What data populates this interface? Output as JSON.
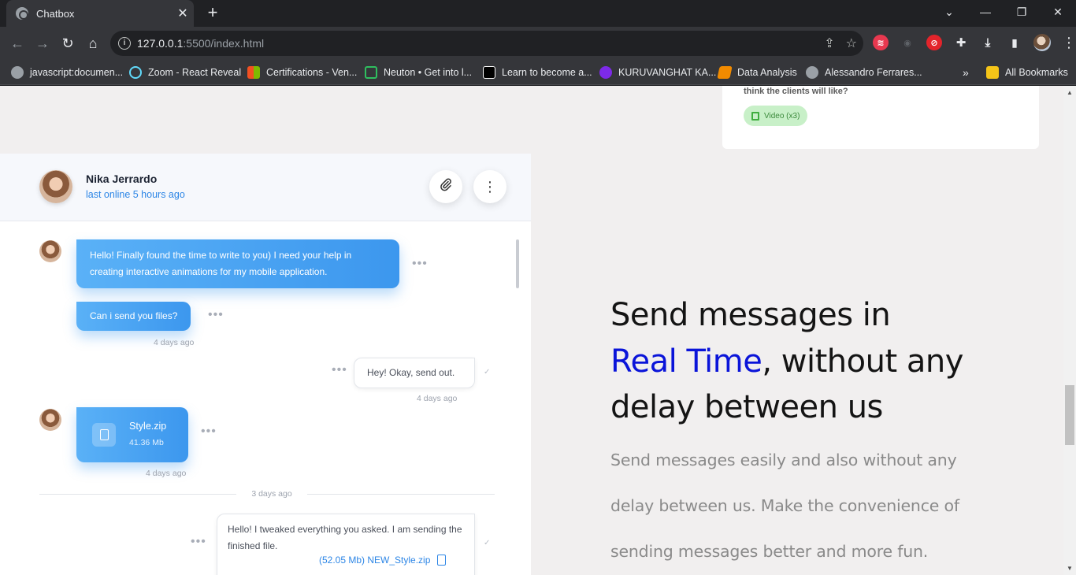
{
  "browser": {
    "tab_title": "Chatbox",
    "url_host": "127.0.0.1",
    "url_path": ":5500/index.html",
    "bookmarks": [
      {
        "label": "javascript:documen...",
        "icon": "globe-icon",
        "color": "#9aa0a6"
      },
      {
        "label": "Zoom - React Reveal",
        "icon": "react-icon",
        "color": "#61dafb"
      },
      {
        "label": "Certifications - Ven...",
        "icon": "microsoft-icon",
        "color": "#f25022"
      },
      {
        "label": "Neuton • Get into l...",
        "icon": "neuton-icon",
        "color": "#2fbf5f"
      },
      {
        "label": "Learn to become a...",
        "icon": "roadmap-icon",
        "color": "#ffffff"
      },
      {
        "label": "KURUVANGHAT KA...",
        "icon": "canva-icon",
        "color": "#7d2ae8"
      },
      {
        "label": "Data Analysis",
        "icon": "book-icon",
        "color": "#f28b00"
      },
      {
        "label": "Alessandro Ferrares...",
        "icon": "globe-icon",
        "color": "#9aa0a6"
      }
    ],
    "all_bookmarks": "All Bookmarks"
  },
  "top_card": {
    "text": "think the clients will like?",
    "pill": "Video (x3)"
  },
  "chat": {
    "contact_name": "Nika Jerrardo",
    "contact_status": "last online 5 hours ago",
    "messages": [
      {
        "text": "Hello! Finally found the time to write to you) I need your help in creating interactive animations for my mobile application."
      },
      {
        "text": "Can i send you files?",
        "time": "4 days ago"
      },
      {
        "text": "Hey! Okay, send out.",
        "time": "4 days ago"
      }
    ],
    "file": {
      "name": "Style.zip",
      "size": "41.36 Mb",
      "time": "4 days ago"
    },
    "divider": "3 days ago",
    "last_message": {
      "text": "Hello! I tweaked everything you asked. I am sending the finished file.",
      "file": "(52.05 Mb) NEW_Style.zip"
    }
  },
  "hero": {
    "title_part1": "Send messages in",
    "title_accent": "Real Time",
    "title_part2": ", without any delay between us",
    "subtitle": "Send messages easily and also without any delay between us. Make the convenience of sending messages better and more fun."
  },
  "colors": {
    "accent_blue": "#0a14d9",
    "bubble_blue": "#3c97ee",
    "status_blue": "#2d86e6"
  }
}
